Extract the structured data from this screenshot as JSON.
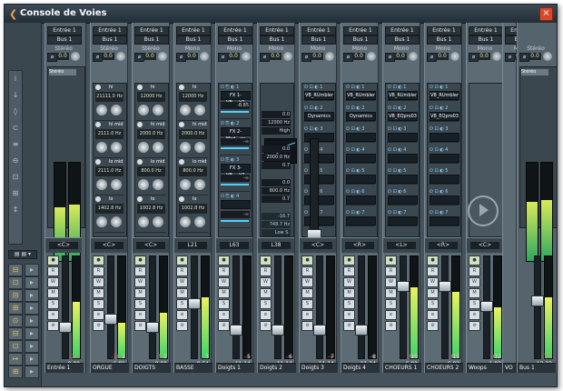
{
  "window": {
    "title": "Console de Voies",
    "close": "×"
  },
  "left_toolbar": {
    "icons": [
      "i",
      "↓",
      "◊",
      "⊂",
      "≡",
      "⊖",
      "⊡",
      "⊞",
      "↕"
    ]
  },
  "left_buttons": [
    "⊟",
    "⊡",
    "⊟",
    "⊞",
    "⊙",
    "⊟",
    "⊡",
    "↦",
    "⊞"
  ],
  "strips": [
    {
      "name": "Entrée 1",
      "route1": "Entrée 1",
      "route2": "Bus 1",
      "mode": "Stéréo",
      "vol": "0.0",
      "num": "",
      "level": "0.00",
      "peak": "-2.1",
      "type": "input",
      "pan": "<C>",
      "meter": 0.55
    },
    {
      "name": "ORGUE",
      "route1": "Entrée 1",
      "route2": "Bus 1",
      "mode": "Stéréo",
      "vol": "0.0",
      "num": "1",
      "level": "-6.81",
      "peak": "-10.9",
      "type": "ch",
      "pan": "<C>",
      "meter": 0.35
    },
    {
      "name": "DOIGTS",
      "route1": "Entrée 1",
      "route2": "Bus 1",
      "mode": "Stéréo",
      "vol": "0.0",
      "num": "2",
      "level": "0.00",
      "peak": "-5.3",
      "type": "ch",
      "pan": "<C>",
      "meter": 0.45
    },
    {
      "name": "BASSE",
      "route1": "Entrée 1",
      "route2": "Bus 1",
      "mode": "Mono",
      "vol": "0.0",
      "num": "3",
      "level": "-0.64",
      "peak": "-7",
      "type": "ch",
      "pan": "L21",
      "meter": 0.6
    },
    {
      "name": "Doigts 1",
      "route1": "Entrée 1",
      "route2": "Bus 1",
      "mode": "Mono",
      "vol": "0.0",
      "num": "5",
      "level": "-11.14",
      "peak": "-∞",
      "type": "ch",
      "pan": "L63",
      "meter": 0.0
    },
    {
      "name": "Doigts 2",
      "route1": "Entrée 1",
      "route2": "Bus 1",
      "mode": "Mono",
      "vol": "0.0",
      "num": "6",
      "level": "-11.14",
      "peak": "-∞",
      "type": "ch",
      "pan": "L38",
      "meter": 0.0
    },
    {
      "name": "Doigts 3",
      "route1": "Entrée 1",
      "route2": "Bus 1",
      "mode": "Mono",
      "vol": "0.0",
      "num": "7",
      "level": "-11.14",
      "peak": "-∞",
      "type": "ch",
      "pan": "<C>",
      "meter": 0.0
    },
    {
      "name": "Doigts 4",
      "route1": "Entrée 1",
      "route2": "Bus 1",
      "mode": "Mono",
      "vol": "0.0",
      "num": "8",
      "level": "-11.14",
      "peak": "-∞",
      "type": "ch",
      "pan": "<R>",
      "meter": 0.0
    },
    {
      "name": "CHOEURS 1",
      "route1": "Entrée 1",
      "route2": "Bus 1",
      "mode": "Mono",
      "vol": "0.0",
      "num": "10",
      "level": "6.02",
      "peak": "9.8",
      "type": "ch",
      "pan": "<L>",
      "meter": 0.7
    },
    {
      "name": "CHOEURS 2",
      "route1": "Entrée 1",
      "route2": "Bus 1",
      "mode": "Mono",
      "vol": "0.0",
      "num": "11",
      "level": "6.02",
      "peak": "8.0",
      "type": "ch",
      "pan": "<R>",
      "meter": 0.65
    },
    {
      "name": "Woops",
      "route1": "Entrée 1",
      "route2": "Bus 1",
      "mode": "Mono",
      "vol": "0.0",
      "num": "12",
      "level": "-1.83",
      "peak": "-6.5",
      "type": "ch",
      "pan": "<C>",
      "meter": 0.5
    },
    {
      "name": "VO",
      "route1": "Entrée 1",
      "route2": "Bus 1",
      "mode": "Mono",
      "vol": "0.0",
      "num": "",
      "level": "",
      "peak": "",
      "type": "ch",
      "pan": "",
      "meter": 0.0
    },
    {
      "name": "Bus 1",
      "route1": "",
      "route2": "",
      "mode": "Stéréo",
      "vol": "0.0",
      "num": "",
      "level": "-13.33",
      "peak": "-7.6",
      "type": "output",
      "pan": "",
      "meter": 0.6
    }
  ],
  "fx": [
    {
      "slot": "FX 1-VB_...V1",
      "val": "-8.85"
    },
    {
      "slot": "FX 2-Mod...ay",
      "val": "-∞"
    },
    {
      "slot": "FX 3-VB_...V1",
      "val": "-∞"
    },
    {
      "slot": "",
      "val": "-∞"
    }
  ],
  "inserts": [
    "VB_RUmbler",
    "VB_RUmbler",
    "VB_RUmbler",
    "VB_RUmbler"
  ],
  "inserts2": [
    "Dynamics",
    "Dynamics",
    "VB_EQpro03",
    "VB_EQpro03"
  ],
  "eq_readout": {
    "b1_gain": "0.0",
    "b1_freq": "12000 Hz",
    "b1_type": "High",
    "b2_gain": "0.0",
    "b2_freq": "2000.0 Hz",
    "b2_q": "0.7",
    "b3_gain": "0.0",
    "b3_freq": "800.0 Hz",
    "b3_q": "0.7",
    "b4_gain": "-16.7",
    "b4_freq": "748.7 Hz",
    "b4_type": "Low S."
  },
  "eq_small": {
    "row1": [
      "21111.0 Hz",
      "12000 Hz"
    ],
    "row2": [
      "2111.0 Hz",
      "2000.0 Hz"
    ],
    "row3": [
      "2111.0 Hz",
      "800.0 Hz"
    ],
    "row4": [
      "1402.8 Hz",
      "1002.8 Hz"
    ],
    "labels": [
      "hi",
      "hi mid",
      "lo mid",
      "lo"
    ]
  }
}
